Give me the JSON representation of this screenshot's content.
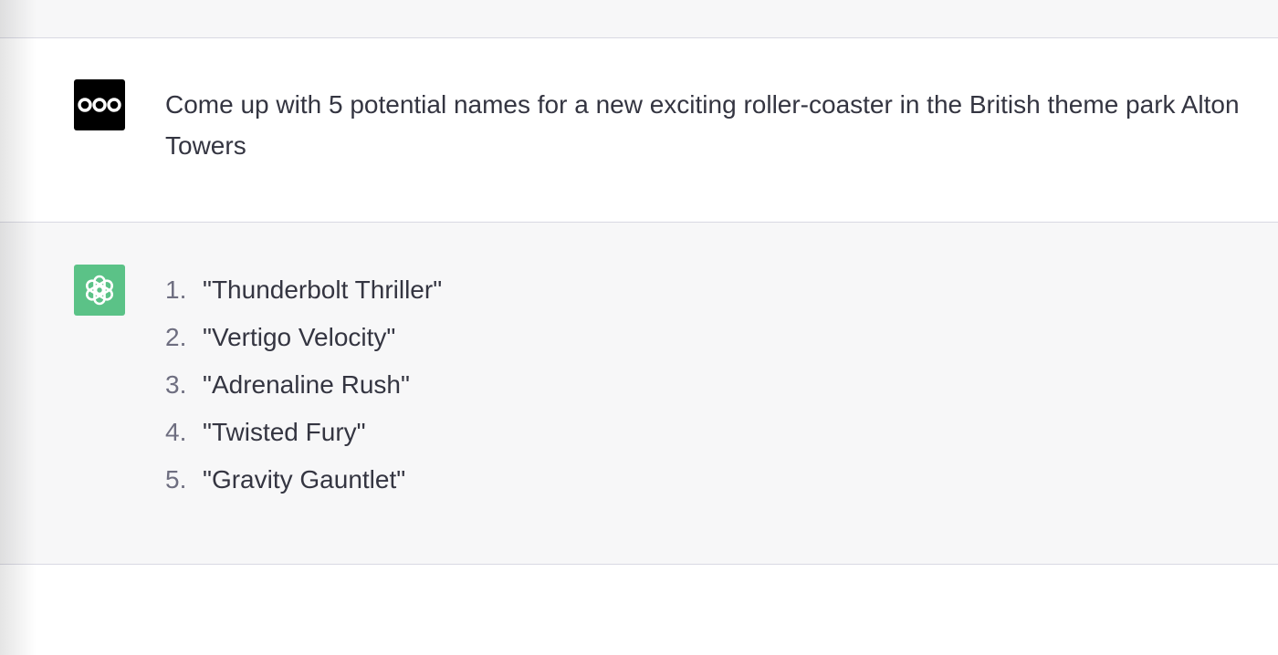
{
  "conversation": {
    "user_message": {
      "avatar_icon": "ooo-logo-icon",
      "text": "Come up with 5 potential names for a new exciting roller-coaster in the British theme park Alton Towers"
    },
    "assistant_message": {
      "avatar_icon": "openai-logo-icon",
      "avatar_color": "#5bc287",
      "items": [
        {
          "num": "1.",
          "text": "\"Thunderbolt Thriller\""
        },
        {
          "num": "2.",
          "text": "\"Vertigo Velocity\""
        },
        {
          "num": "3.",
          "text": "\"Adrenaline Rush\""
        },
        {
          "num": "4.",
          "text": "\"Twisted Fury\""
        },
        {
          "num": "5.",
          "text": "\"Gravity Gauntlet\""
        }
      ]
    }
  }
}
